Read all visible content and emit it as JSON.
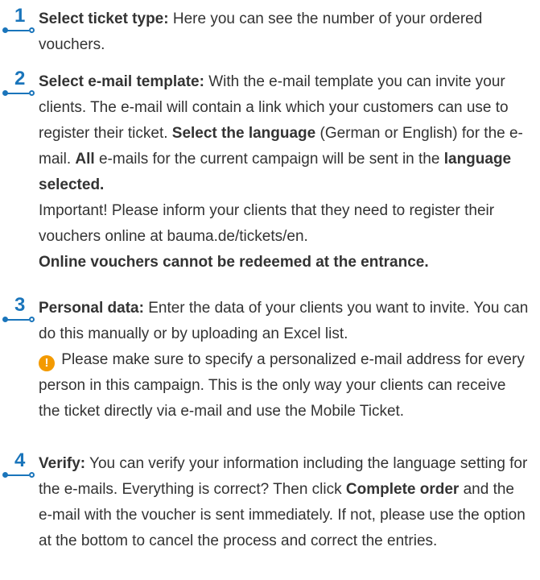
{
  "steps": [
    {
      "number": "1",
      "title": "Select ticket type:",
      "text": " Here you can see the number of your ordered vouchers."
    },
    {
      "number": "2",
      "title": "Select e-mail template:",
      "text_a": " With the e-mail template you can invite your clients. The e-mail will contain a link which your customers can use to register their ticket. ",
      "bold_a": "Select the language",
      "text_b": " (German or English) for the e-mail. ",
      "bold_b": "All",
      "text_c": " e-mails for the current campaign will be sent in the ",
      "bold_c": "language selected.",
      "important": "Important! Please inform your clients that they need to register their vouchers online at bauma.de/tickets/en.",
      "warning": "Online vouchers cannot be redeemed at the entrance."
    },
    {
      "number": "3",
      "title": "Personal data:",
      "text": " Enter the data of your clients you want to invite. You can do this manually or by uploading an Excel list.",
      "icon": "exclamation-icon",
      "icon_glyph": "!",
      "note": " Please make sure to specify a personalized e-mail address for every person in this campaign. This is the only way your clients can receive the ticket directly via e-mail and use the Mobile Ticket."
    },
    {
      "number": "4",
      "title": "Verify:",
      "text_a": " You can verify your information including the language setting for the e-mails. Everything is correct? Then click ",
      "bold_a": "Complete order",
      "text_b": " and the e-mail with the voucher is sent immediately. If not, please use the option at the bottom to cancel the process and correct the entries."
    }
  ],
  "colors": {
    "accent": "#1a75bb",
    "warning": "#f39a00",
    "text": "#333333"
  }
}
